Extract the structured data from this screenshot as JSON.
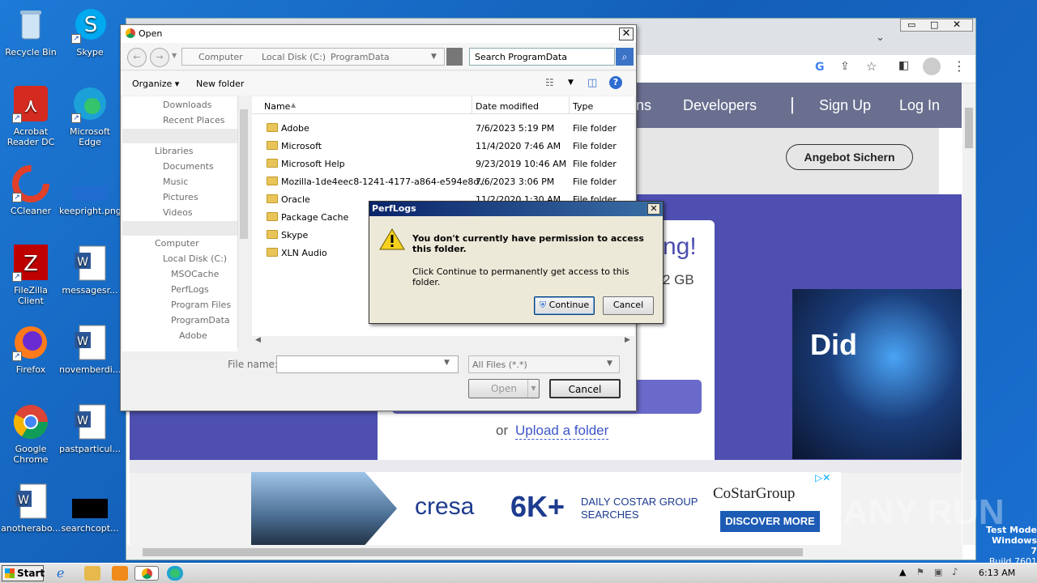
{
  "desktop_icons": [
    {
      "label": "Recycle Bin",
      "icon": "recycle-bin-icon"
    },
    {
      "label": "Skype",
      "icon": "skype-icon"
    },
    {
      "label": "Acrobat Reader DC",
      "icon": "acrobat-icon"
    },
    {
      "label": "Microsoft Edge",
      "icon": "edge-icon"
    },
    {
      "label": "CCleaner",
      "icon": "ccleaner-icon"
    },
    {
      "label": "keepright.png",
      "icon": "image-file-icon"
    },
    {
      "label": "FileZilla Client",
      "icon": "filezilla-icon"
    },
    {
      "label": "messagesr...",
      "icon": "word-doc-icon"
    },
    {
      "label": "Firefox",
      "icon": "firefox-icon"
    },
    {
      "label": "novemberdi...",
      "icon": "word-doc-icon"
    },
    {
      "label": "Google Chrome",
      "icon": "chrome-icon"
    },
    {
      "label": "pastparticul...",
      "icon": "word-doc-icon"
    },
    {
      "label": "anotherabo...",
      "icon": "word-doc-icon"
    },
    {
      "label": "searchcopt...",
      "icon": "black-file-icon"
    }
  ],
  "website": {
    "nav": {
      "partial": "ns",
      "developers": "Developers",
      "signup": "Sign Up",
      "login": "Log In"
    },
    "cta_button": "Angebot Sichern",
    "card_partial_heading": "ng!",
    "card_partial_size": "2 GB",
    "upload_or": "or",
    "upload_link": "Upload a folder",
    "promo_text": "Did",
    "ad": {
      "brand": "cresa",
      "big": "6K+",
      "line1": "DAILY COSTAR GROUP",
      "line2": "SEARCHES",
      "costar": "CoStarGroup",
      "discover": "DISCOVER MORE"
    }
  },
  "open_dialog": {
    "title": "Open",
    "breadcrumb": [
      "Computer",
      "Local Disk (C:)",
      "ProgramData"
    ],
    "search_placeholder": "Search ProgramData",
    "organize": "Organize",
    "new_folder": "New folder",
    "tree": [
      {
        "label": "Downloads"
      },
      {
        "label": "Recent Places"
      },
      {
        "label": "Libraries"
      },
      {
        "label": "Documents"
      },
      {
        "label": "Music"
      },
      {
        "label": "Pictures"
      },
      {
        "label": "Videos"
      },
      {
        "label": "Computer"
      },
      {
        "label": "Local Disk (C:)"
      },
      {
        "label": "MSOCache"
      },
      {
        "label": "PerfLogs"
      },
      {
        "label": "Program Files"
      },
      {
        "label": "ProgramData"
      },
      {
        "label": "Adobe"
      }
    ],
    "columns": [
      "Name",
      "Date modified",
      "Type"
    ],
    "rows": [
      {
        "name": "Adobe",
        "date": "7/6/2023 5:19 PM",
        "type": "File folder"
      },
      {
        "name": "Microsoft",
        "date": "11/4/2020 7:46 AM",
        "type": "File folder"
      },
      {
        "name": "Microsoft Help",
        "date": "9/23/2019 10:46 AM",
        "type": "File folder"
      },
      {
        "name": "Mozilla-1de4eec8-1241-4177-a864-e594e8d...",
        "date": "7/6/2023 3:06 PM",
        "type": "File folder"
      },
      {
        "name": "Oracle",
        "date": "11/2/2020 1:30 AM",
        "type": "File folder"
      },
      {
        "name": "Package Cache",
        "date": "",
        "type": ""
      },
      {
        "name": "Skype",
        "date": "",
        "type": ""
      },
      {
        "name": "XLN Audio",
        "date": "",
        "type": ""
      }
    ],
    "filename_label": "File name:",
    "filename_value": "",
    "filter": "All Files (*.*)",
    "open_button": "Open",
    "cancel_button": "Cancel"
  },
  "perm_dialog": {
    "title": "PerfLogs",
    "message": "You don't currently have permission to access this folder.",
    "sub": "Click Continue to permanently get access to this folder.",
    "continue": "Continue",
    "cancel": "Cancel"
  },
  "watermark": {
    "text": "ANY RUN",
    "mode1": "Test Mode",
    "mode2": "Windows 7",
    "mode3": "Build 7601"
  },
  "taskbar": {
    "start": "Start",
    "time": "6:13 AM"
  }
}
